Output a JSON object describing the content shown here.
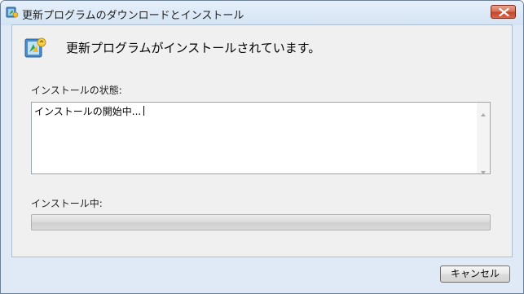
{
  "window": {
    "title": "更新プログラムのダウンロードとインストール"
  },
  "main": {
    "heading": "更新プログラムがインストールされています。",
    "status_label": "インストールの状態:",
    "status_text": "インストールの開始中...",
    "progress_label": "インストール中:",
    "progress_fraction": 0
  },
  "footer": {
    "cancel_label": "キャンセル"
  },
  "icons": {
    "title": "windows-update-icon",
    "close": "close-icon",
    "main": "windows-update-icon",
    "scroll_up": "scroll-up-arrow-icon",
    "scroll_down": "scroll-down-arrow-icon"
  },
  "colors": {
    "close_button": "#c3472a",
    "frame": "#dfeaf6"
  }
}
